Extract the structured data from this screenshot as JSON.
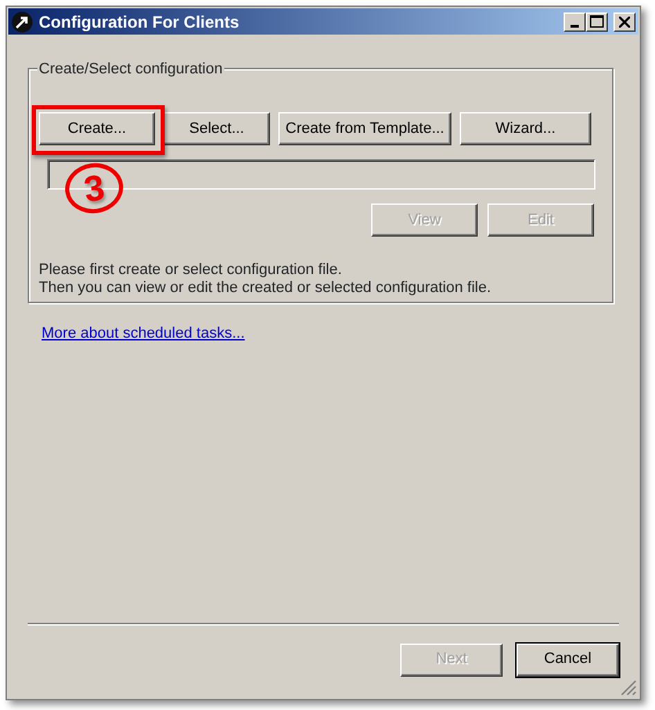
{
  "window": {
    "title": "Configuration For Clients"
  },
  "group": {
    "label": "Create/Select configuration",
    "top_buttons": [
      {
        "label": "Create...",
        "disabled": false,
        "highlighted": true
      },
      {
        "label": "Select...",
        "disabled": false,
        "highlighted": false
      },
      {
        "label": "Create from Template...",
        "disabled": false,
        "highlighted": false
      },
      {
        "label": "Wizard...",
        "disabled": false,
        "highlighted": false
      }
    ],
    "action_buttons": [
      {
        "label": "View",
        "disabled": true
      },
      {
        "label": "Edit",
        "disabled": true
      }
    ],
    "info": [
      "Please first create or select configuration file.",
      "Then you can view or edit the created or selected configuration file."
    ]
  },
  "annotation": {
    "step": "3"
  },
  "link": "More about scheduled tasks...",
  "footer_buttons": [
    {
      "label": "Next",
      "disabled": true,
      "default": false
    },
    {
      "label": "Cancel",
      "disabled": false,
      "default": true
    }
  ]
}
